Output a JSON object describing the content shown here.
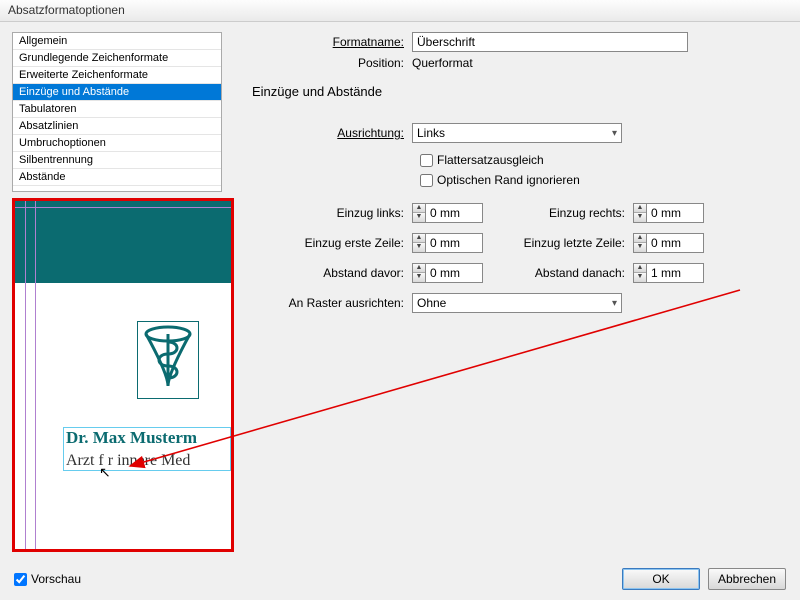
{
  "dialog": {
    "title": "Absatzformatoptionen"
  },
  "sidebar": {
    "items": [
      "Allgemein",
      "Grundlegende Zeichenformate",
      "Erweiterte Zeichenformate",
      "Einzüge und Abstände",
      "Tabulatoren",
      "Absatzlinien",
      "Umbruchoptionen",
      "Silbentrennung",
      "Abstände"
    ],
    "selected_index": 3
  },
  "header": {
    "formatname_label": "Formatname:",
    "formatname_value": "Überschrift",
    "position_label": "Position:",
    "position_value": "Querformat"
  },
  "section": {
    "title": "Einzüge und Abstände"
  },
  "alignment": {
    "label": "Ausrichtung:",
    "value": "Links"
  },
  "checks": {
    "flatter": "Flattersatzausgleich",
    "optical": "Optischen Rand ignorieren"
  },
  "fields": {
    "einzug_links": {
      "label": "Einzug links:",
      "value": "0 mm"
    },
    "einzug_rechts": {
      "label": "Einzug rechts:",
      "value": "0 mm"
    },
    "einzug_erste": {
      "label": "Einzug erste Zeile:",
      "value": "0 mm"
    },
    "einzug_letzte": {
      "label": "Einzug letzte Zeile:",
      "value": "0 mm"
    },
    "davor": {
      "label": "Abstand davor:",
      "value": "0 mm"
    },
    "danach": {
      "label": "Abstand danach:",
      "value": "1 mm"
    }
  },
  "grid": {
    "label": "An Raster ausrichten:",
    "value": "Ohne"
  },
  "footer": {
    "preview_label": "Vorschau",
    "ok": "OK",
    "cancel": "Abbrechen"
  },
  "preview": {
    "name": "Dr. Max Musterm",
    "sub": "Arzt f  r innere Med"
  }
}
